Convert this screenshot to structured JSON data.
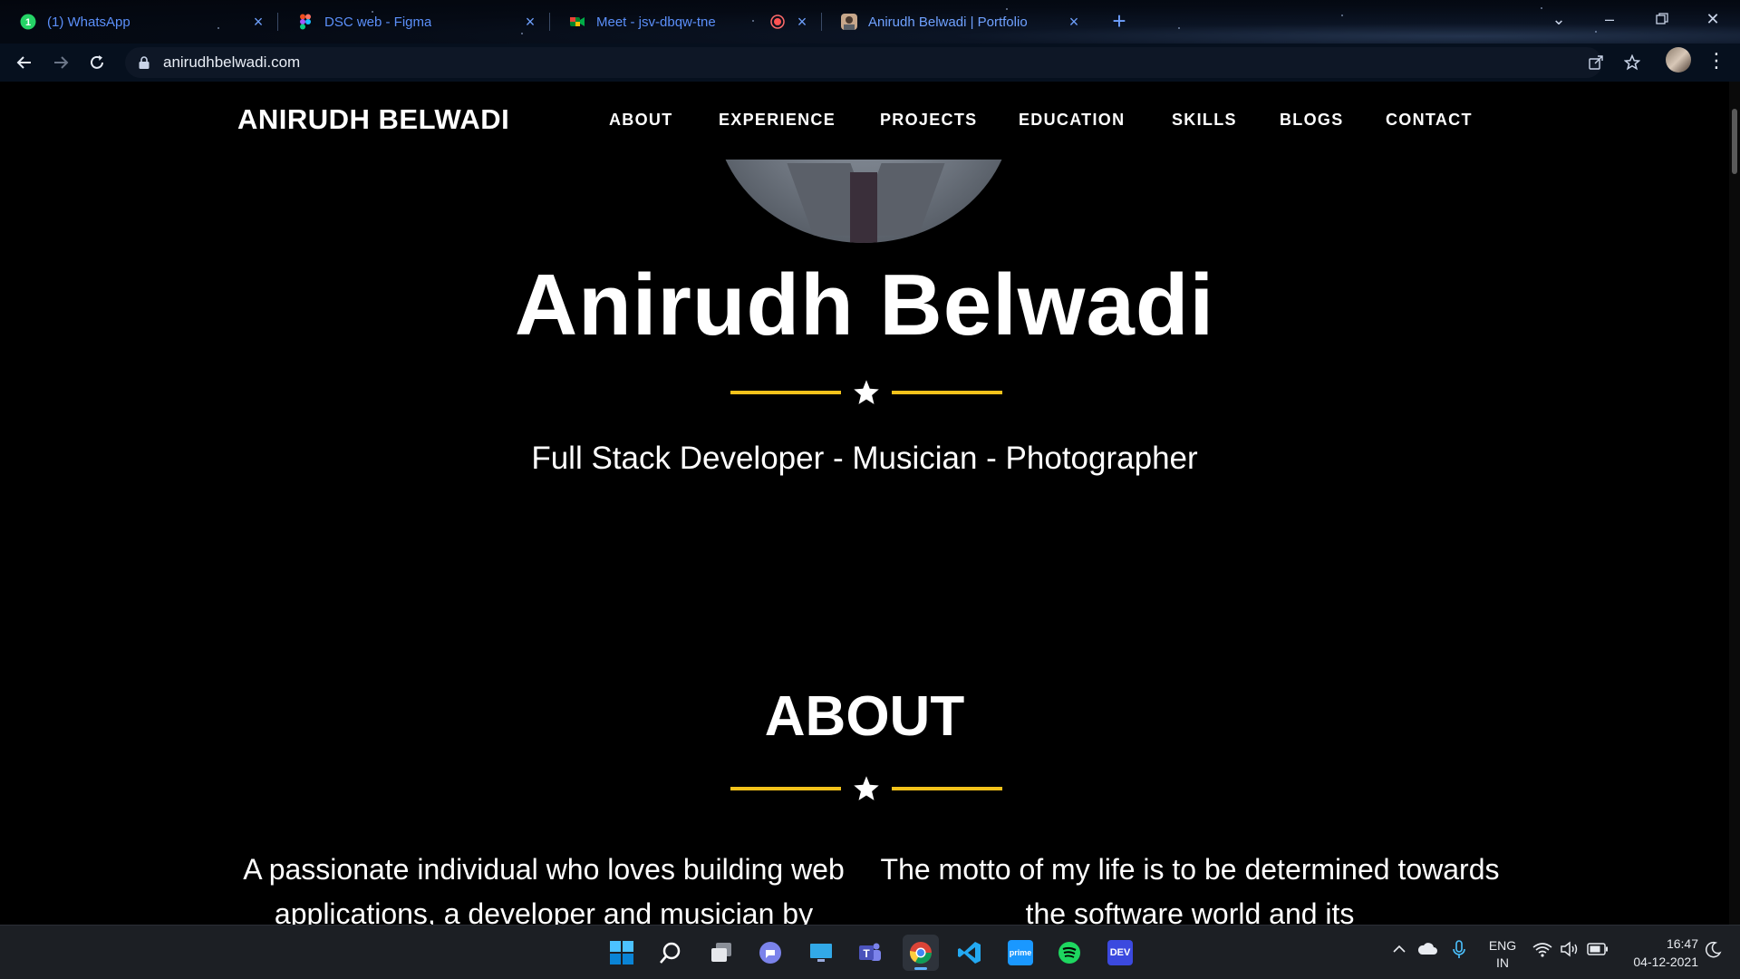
{
  "browser": {
    "tabs": [
      {
        "title": "(1) WhatsApp",
        "favicon": "whatsapp-icon",
        "active": false
      },
      {
        "title": "DSC web - Figma",
        "favicon": "figma-icon",
        "active": false
      },
      {
        "title": "Meet - jsv-dbqw-tne",
        "favicon": "google-meet-icon",
        "active": false,
        "recording": true
      },
      {
        "title": "Anirudh Belwadi | Portfolio",
        "favicon": "portfolio-favicon",
        "active": true
      }
    ],
    "url": "anirudhbelwadi.com",
    "load_progress": 0.03,
    "colors": {
      "tab_text": "#6fa1ff",
      "omnibox": "#0e1726"
    }
  },
  "site": {
    "brand": "ANIRUDH BELWADI",
    "nav": [
      "ABOUT",
      "EXPERIENCE",
      "PROJECTS",
      "EDUCATION",
      "SKILLS",
      "BLOGS",
      "CONTACT"
    ],
    "hero": {
      "name": "Anirudh Belwadi",
      "tagline": "Full Stack Developer - Musician - Photographer"
    },
    "about": {
      "title": "ABOUT",
      "left_text": "A passionate individual who loves building web applications, a developer and musician by",
      "right_text": "The motto of my life is to be determined towards the software world and its"
    },
    "colors": {
      "accent": "#f4c21b",
      "background": "#000000",
      "text": "#ffffff"
    }
  },
  "taskbar": {
    "apps": [
      "windows-start",
      "search",
      "task-view",
      "chat",
      "desktop",
      "teams",
      "chrome",
      "vscode",
      "prime-video",
      "spotify",
      "dev-home"
    ],
    "language": {
      "line1": "ENG",
      "line2": "IN"
    },
    "time": "16:47",
    "date": "04-12-2021"
  }
}
